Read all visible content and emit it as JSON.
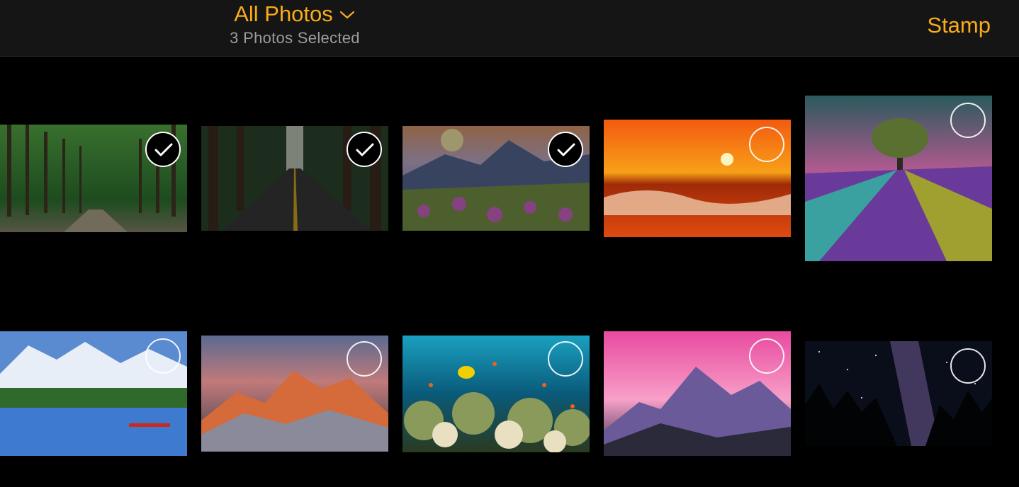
{
  "header": {
    "title": "All Photos",
    "subtitle": "3 Photos Selected",
    "action_label": "Stamp",
    "accent_color": "#f9ab19",
    "title_icon": "chevron-down-icon"
  },
  "photos": [
    {
      "id": "forest-path",
      "selected": true
    },
    {
      "id": "redwood-road",
      "selected": true
    },
    {
      "id": "mountain-flowers-sunrise",
      "selected": true
    },
    {
      "id": "ocean-sunset-wave",
      "selected": false
    },
    {
      "id": "lavender-field-tree",
      "selected": false
    },
    {
      "id": "mountain-lake-canoe",
      "selected": false
    },
    {
      "id": "sunset-peaks",
      "selected": false
    },
    {
      "id": "coral-reef",
      "selected": false
    },
    {
      "id": "pink-sky-mountains",
      "selected": false
    },
    {
      "id": "milky-way-forest",
      "selected": false
    }
  ]
}
